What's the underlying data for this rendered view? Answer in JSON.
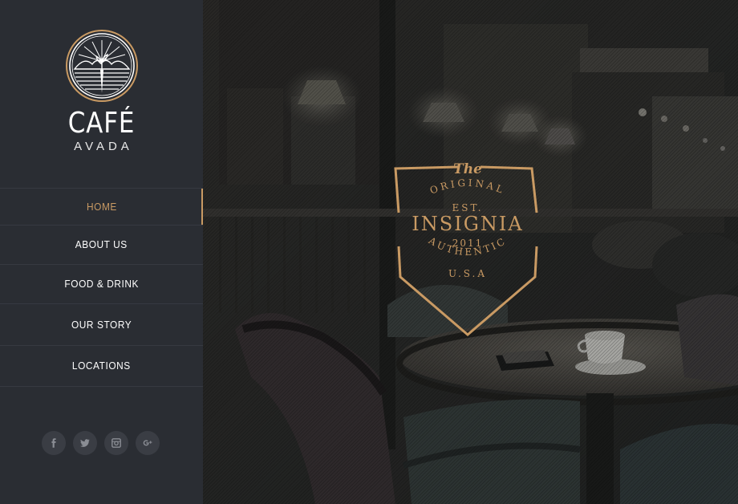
{
  "brand": {
    "name": "CAFÉ",
    "sub": "AVADA"
  },
  "nav": {
    "items": [
      {
        "label": "HOME",
        "active": true
      },
      {
        "label": "ABOUT US",
        "active": false
      },
      {
        "label": "FOOD & DRINK",
        "active": false
      },
      {
        "label": "OUR STORY",
        "active": false
      },
      {
        "label": "LOCATIONS",
        "active": false
      }
    ]
  },
  "social": [
    {
      "icon": "facebook-icon"
    },
    {
      "icon": "twitter-icon"
    },
    {
      "icon": "instagram-icon"
    },
    {
      "icon": "google-plus-icon"
    }
  ],
  "badge": {
    "the": "The",
    "original": "ORIGINAL",
    "est": "EST.",
    "title": "INSIGNIA",
    "year": "2011",
    "authentic": "AUTHENTIC",
    "country": "U.S.A"
  },
  "colors": {
    "accent": "#c99a63",
    "sidebar_bg": "#2a2d33",
    "divider": "#363941",
    "social_bg": "#3a3d44"
  }
}
